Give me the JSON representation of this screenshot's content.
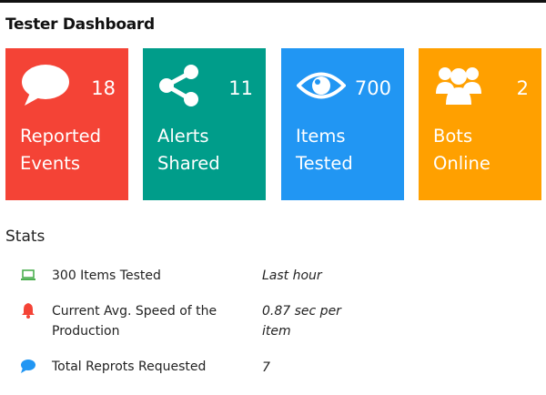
{
  "header": {
    "title": "Tester Dashboard"
  },
  "cards": [
    {
      "count": "18",
      "label_line1": "Reported",
      "label_line2": "Events",
      "icon": "speech-bubble-icon",
      "color": "#f44336"
    },
    {
      "count": "11",
      "label_line1": "Alerts",
      "label_line2": "Shared",
      "icon": "share-icon",
      "color": "#009d8a"
    },
    {
      "count": "700",
      "label_line1": "Items",
      "label_line2": "Tested",
      "icon": "eye-icon",
      "color": "#2196f3"
    },
    {
      "count": "2",
      "label_line1": "Bots",
      "label_line2": "Online",
      "icon": "users-icon",
      "color": "#ffa000"
    }
  ],
  "stats": {
    "title": "Stats",
    "rows": [
      {
        "label": "300 Items Tested",
        "value": "Last hour",
        "icon": "laptop-icon",
        "icon_color": "#4caf50"
      },
      {
        "label": "Current Avg. Speed of the Production",
        "value": "0.87 sec per item",
        "icon": "bell-icon",
        "icon_color": "#f44336"
      },
      {
        "label": "Total Reprots Requested",
        "value": "7",
        "icon": "comment-icon",
        "icon_color": "#2196f3"
      }
    ]
  }
}
